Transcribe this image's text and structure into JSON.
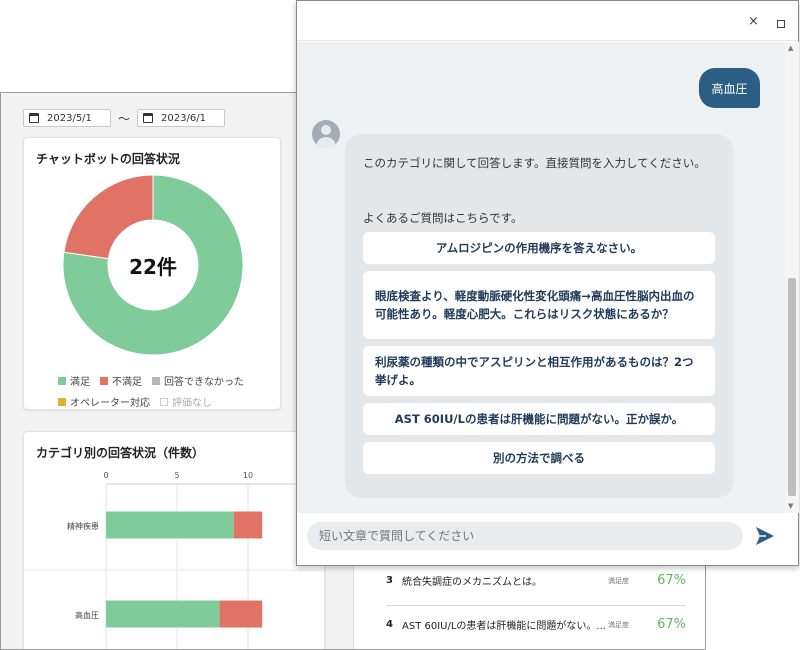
{
  "dashboard": {
    "date_from": "2023/5/1",
    "date_sep": "〜",
    "date_to": "2023/6/1",
    "donut_card": {
      "title": "チャットボットの回答状況",
      "center_label": "22件",
      "legend": [
        {
          "label": "満足",
          "color": "#7fcb9a"
        },
        {
          "label": "不満足",
          "color": "#e07366"
        },
        {
          "label": "回答できなかった",
          "color": "#b0b7bf"
        },
        {
          "label": "オペレーター対応",
          "color": "#e3b02c"
        },
        {
          "label": "評価なし",
          "color": "#ffffff"
        }
      ]
    },
    "bar_card": {
      "title": "カテゴリ別の回答状況（件数）"
    },
    "list_rows": [
      {
        "num": "3",
        "question": "統合失調症のメカニズムとは。",
        "tag": "満足度",
        "pct": "67%"
      },
      {
        "num": "4",
        "question": "AST 60IU/Lの患者は肝機能に問題がない。...",
        "tag": "満足度",
        "pct": "67%"
      }
    ]
  },
  "chart_data": [
    {
      "type": "pie",
      "title": "チャットボットの回答状況",
      "categories": [
        "満足",
        "不満足",
        "回答できなかった",
        "オペレーター対応",
        "評価なし"
      ],
      "values": [
        17,
        5,
        0,
        0,
        0
      ],
      "center_text": "22件",
      "colors": [
        "#7fcb9a",
        "#e07366",
        "#b0b7bf",
        "#e3b02c",
        "#ffffff"
      ]
    },
    {
      "type": "bar",
      "orientation": "horizontal",
      "stacked": true,
      "title": "カテゴリ別の回答状況（件数）",
      "categories": [
        "精神疾患",
        "高血圧"
      ],
      "series": [
        {
          "name": "満足",
          "values": [
            9,
            8
          ],
          "color": "#7fcb9a"
        },
        {
          "name": "不満足",
          "values": [
            2,
            3
          ],
          "color": "#e07366"
        }
      ],
      "xticks": [
        0,
        5,
        10
      ],
      "xlim": [
        0,
        12
      ]
    }
  ],
  "chat": {
    "close_icon": "×",
    "user_message": "高血圧",
    "bot_intro": "このカテゴリに関して回答します。直接質問を入力してください。",
    "bot_faq_header": "よくあるご質問はこちらです。",
    "options": [
      "アムロジピンの作用機序を答えなさい。",
      "眼底検査より、軽度動脈硬化性変化頭痛→高血圧性脳内出血の可能性あり。軽度心肥大。これらはリスク状態にあるか？",
      "利尿薬の種類の中でアスピリンと相互作用があるものは？2つ挙げよ。",
      "AST 60IU/Lの患者は肝機能に問題がない。正か誤か。",
      "別の方法で調べる"
    ],
    "input_placeholder": "短い文章で質問してください",
    "colors": {
      "user_bubble": "#2c5e84",
      "option_text": "#1f3a5a",
      "send_icon": "#2c5e84"
    }
  }
}
